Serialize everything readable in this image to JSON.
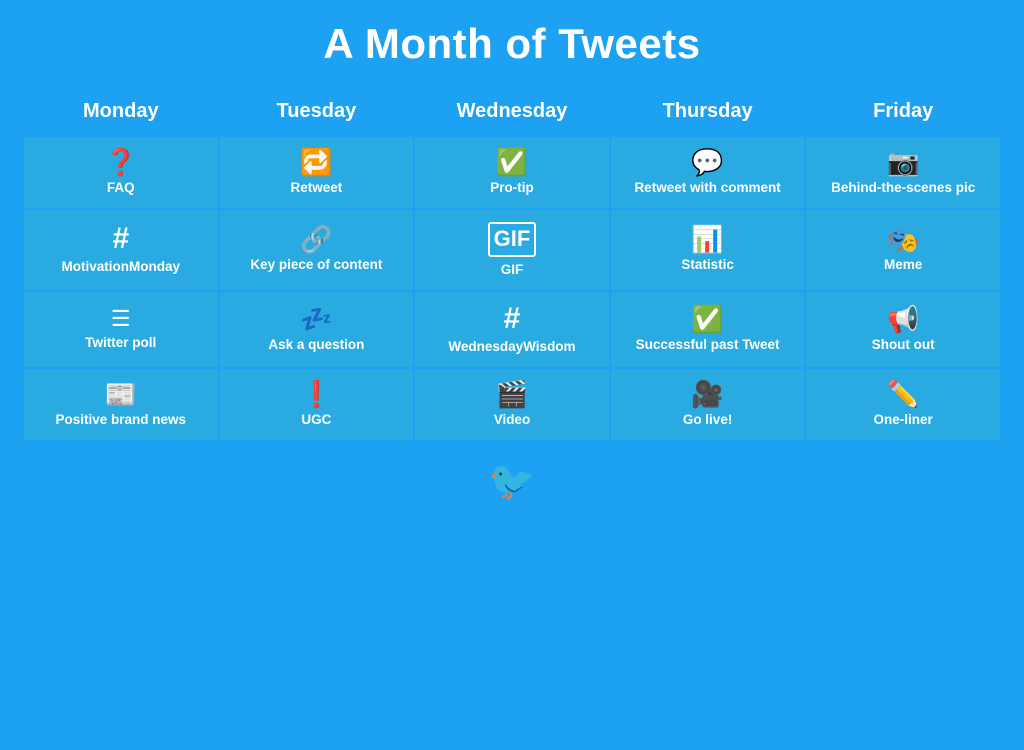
{
  "title": "A Month of Tweets",
  "columns": [
    "Monday",
    "Tuesday",
    "Wednesday",
    "Thursday",
    "Friday"
  ],
  "rows": [
    [
      {
        "icon": "❓",
        "label": "FAQ"
      },
      {
        "icon": "🔁",
        "label": "Retweet"
      },
      {
        "icon": "✅",
        "label": "Pro-tip"
      },
      {
        "icon": "💬",
        "label": "Retweet with comment"
      },
      {
        "icon": "📷",
        "label": "Behind-the-scenes pic"
      }
    ],
    [
      {
        "icon": "#",
        "label": "MotivationMonday"
      },
      {
        "icon": "🔗",
        "label": "Key piece of content"
      },
      {
        "icon": "GIF",
        "label": "GIF"
      },
      {
        "icon": "📊",
        "label": "Statistic"
      },
      {
        "icon": "🎭",
        "label": "Meme"
      }
    ],
    [
      {
        "icon": "☰",
        "label": "Twitter poll"
      },
      {
        "icon": "💤",
        "label": "Ask a question"
      },
      {
        "icon": "#",
        "label": "WednesdayWisdom"
      },
      {
        "icon": "✅",
        "label": "Successful past Tweet"
      },
      {
        "icon": "📢",
        "label": "Shout out"
      }
    ],
    [
      {
        "icon": "📰",
        "label": "Positive brand news"
      },
      {
        "icon": "❗",
        "label": "UGC"
      },
      {
        "icon": "🎬",
        "label": "Video"
      },
      {
        "icon": "🎥",
        "label": "Go live!"
      },
      {
        "icon": "✏️",
        "label": "One-liner"
      }
    ]
  ],
  "footer_icon": "🐦"
}
